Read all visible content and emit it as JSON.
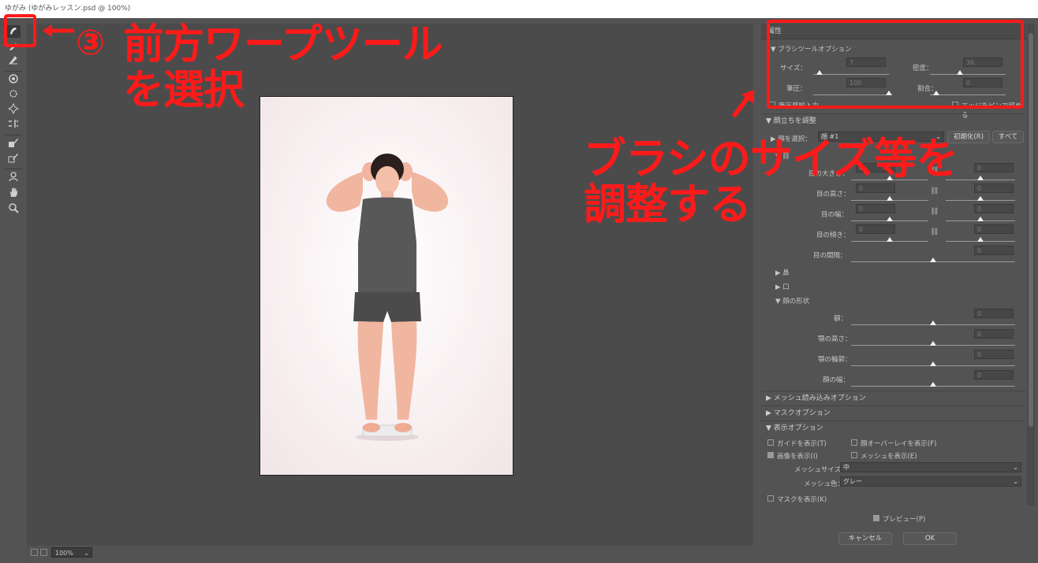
{
  "window": {
    "title": "ゆがみ (ゆがみレッスン.psd @ 100%)"
  },
  "status": {
    "zoom": "100%"
  },
  "panel": {
    "title": "属性",
    "brush_section": "▼ ブラシツールオプション",
    "size_label": "サイズ：",
    "size_value": "7",
    "density_label": "密度：",
    "density_value": "36",
    "pressure_label": "筆圧：",
    "pressure_value": "100",
    "rate_label": "割合：",
    "rate_value": "0",
    "stylus_label": "筆圧感知入力",
    "pin_edges_label": "エッジをピンで留める",
    "face_section": "▼ 顔立ちを調整",
    "face_select_label": "▶ 顔を選択：",
    "face_select_value": "顔 #1",
    "reset_label": "初期化(R)",
    "all_label": "すべて",
    "eyes_label": "▼ 目",
    "eye_rows": [
      {
        "label": "目の大きさ：",
        "left": "0",
        "right": "0"
      },
      {
        "label": "目の高さ：",
        "left": "0",
        "right": "0"
      },
      {
        "label": "目の幅：",
        "left": "0",
        "right": "0"
      },
      {
        "label": "目の傾き：",
        "left": "0",
        "right": "0"
      }
    ],
    "eye_distance": {
      "label": "目の間隔：",
      "value": "0"
    },
    "nose_label": "▶ 鼻",
    "mouth_label": "▶ 口",
    "shape_label": "▼ 顔の形状",
    "shape_rows": [
      {
        "label": "額：",
        "value": "0"
      },
      {
        "label": "顎の高さ：",
        "value": "0"
      },
      {
        "label": "顎の輪郭：",
        "value": "0"
      },
      {
        "label": "顔の幅：",
        "value": "0"
      }
    ],
    "mesh_load_section": "▶ メッシュ読み込みオプション",
    "mask_section": "▶ マスクオプション",
    "view_section": "▼ 表示オプション",
    "show_guides": "ガイドを表示(T)",
    "show_face_overlay": "顔オーバーレイを表示(F)",
    "show_image": "画像を表示(I)",
    "show_mesh": "メッシュを表示(E)",
    "mesh_size_label": "メッシュサイズ：",
    "mesh_size_value": "中",
    "mesh_color_label": "メッシュ色：",
    "mesh_color_value": "グレー",
    "show_mask": "マスクを表示(K)"
  },
  "footer": {
    "preview_label": "プレビュー(P)",
    "cancel_label": "キャンセル",
    "ok_label": "OK"
  },
  "annotations": {
    "circled_number": "③",
    "tool_title_1": "前方ワープツール",
    "tool_title_2": "を選択",
    "brush_note_1": "ブラシのサイズ等を",
    "brush_note_2": "調整する",
    "accent_color": "#ff1a1a"
  },
  "tools": [
    "forward-warp-icon",
    "reconstruct-icon",
    "smooth-icon",
    "twirl-icon",
    "pucker-icon",
    "bloat-icon",
    "push-left-icon",
    "freeze-mask-icon",
    "thaw-mask-icon",
    "face-tool-icon",
    "hand-icon",
    "zoom-icon"
  ]
}
